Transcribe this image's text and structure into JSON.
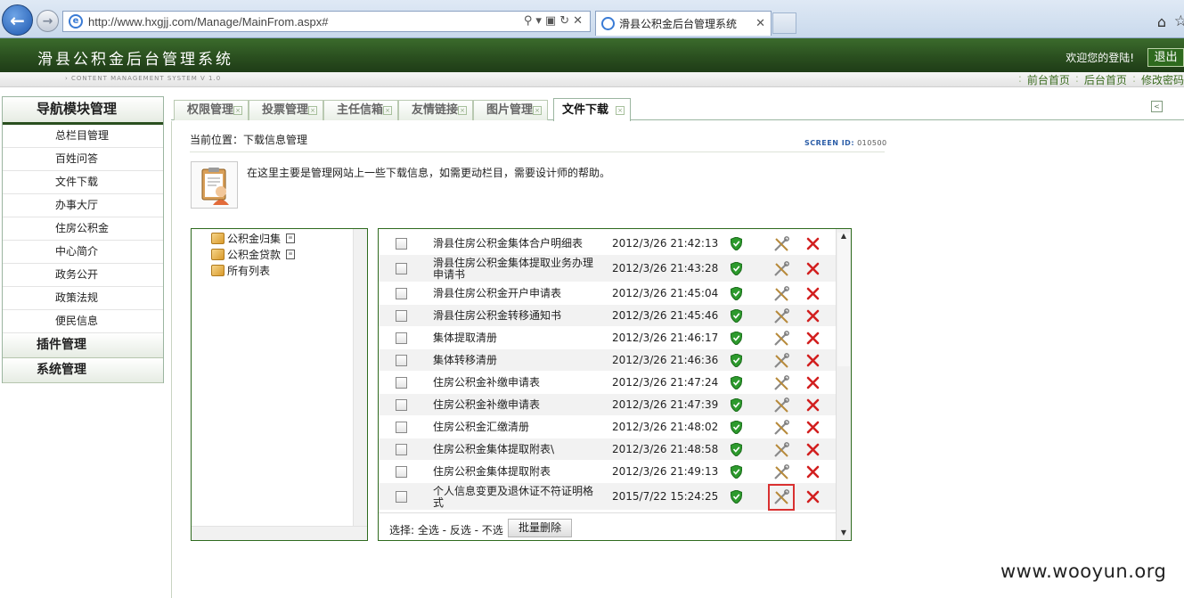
{
  "browser": {
    "url": "http://www.hxgjj.com/Manage/MainFrom.aspx#",
    "tab_title": "滑县公积金后台管理系统"
  },
  "header": {
    "title": "滑县公积金后台管理系统",
    "welcome": "欢迎您的登陆!",
    "logout_label": "退出",
    "system_version": "› CONTENT MANAGEMENT SYSTEM V 1.0",
    "links": [
      "前台首页",
      "后台首页",
      "修改密码"
    ]
  },
  "sidebar": {
    "nav_title": "导航模块管理",
    "items": [
      "总栏目管理",
      "百姓问答",
      "文件下载",
      "办事大厅",
      "住房公积金",
      "中心简介",
      "政务公开",
      "政策法规",
      "便民信息"
    ],
    "sections": [
      "插件管理",
      "系统管理"
    ]
  },
  "tabs": [
    {
      "label": "权限管理"
    },
    {
      "label": "投票管理"
    },
    {
      "label": "主任信箱"
    },
    {
      "label": "友情链接"
    },
    {
      "label": "图片管理"
    },
    {
      "label": "文件下载",
      "active": true
    }
  ],
  "main": {
    "breadcrumb": "当前位置：下载信息管理",
    "screen_id_label": "SCREEN ID:",
    "screen_id": "010500",
    "info": "在这里主要是管理网站上一些下载信息，如需更动栏目，需要设计师的帮助。"
  },
  "tree": {
    "items": [
      "公积金归集",
      "公积金贷款",
      "所有列表"
    ]
  },
  "files": [
    {
      "name": "滑县住房公积金集体合户明细表",
      "date": "2012/3/26 21:42:13"
    },
    {
      "name": "滑县住房公积金集体提取业务办理申请书",
      "date": "2012/3/26 21:43:28"
    },
    {
      "name": "滑县住房公积金开户申请表",
      "date": "2012/3/26 21:45:04"
    },
    {
      "name": "滑县住房公积金转移通知书",
      "date": "2012/3/26 21:45:46"
    },
    {
      "name": "集体提取清册",
      "date": "2012/3/26 21:46:17"
    },
    {
      "name": "集体转移清册",
      "date": "2012/3/26 21:46:36"
    },
    {
      "name": "住房公积金补缴申请表",
      "date": "2012/3/26 21:47:24"
    },
    {
      "name": "住房公积金补缴申请表",
      "date": "2012/3/26 21:47:39"
    },
    {
      "name": "住房公积金汇缴清册",
      "date": "2012/3/26 21:48:02"
    },
    {
      "name": "住房公积金集体提取附表\\",
      "date": "2012/3/26 21:48:58"
    },
    {
      "name": "住房公积金集体提取附表",
      "date": "2012/3/26 21:49:13"
    },
    {
      "name": "个人信息变更及退休证不符证明格式",
      "date": "2015/7/22 15:24:25"
    }
  ],
  "footer": {
    "select_text": "选择: 全选 - 反选 - 不选",
    "batch_delete": "批量删除"
  },
  "watermark": "www.wooyun.org",
  "colors": {
    "header_green": "#2a4f1f",
    "highlight_red": "#d93030"
  }
}
